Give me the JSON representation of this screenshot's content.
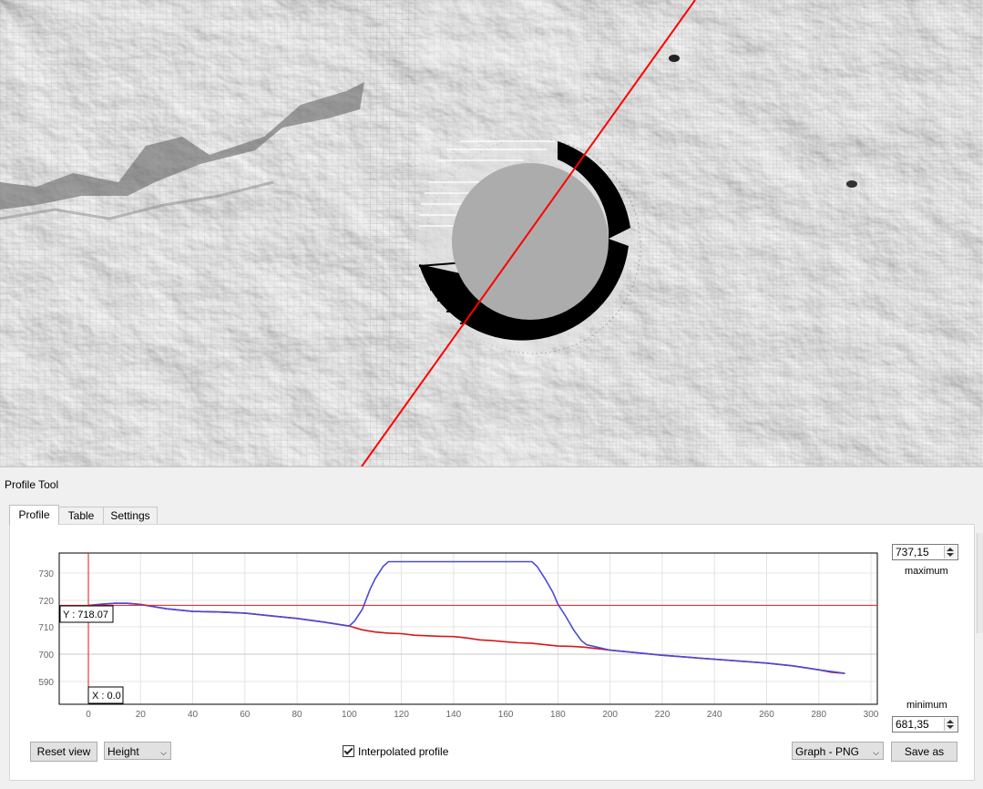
{
  "panel": {
    "title": "Profile Tool"
  },
  "tabs": [
    {
      "label": "Profile",
      "active": true
    },
    {
      "label": "Table",
      "active": false
    },
    {
      "label": "Settings",
      "active": false
    }
  ],
  "cursor": {
    "y_label": "Y : 718.07",
    "x_label": "X : 0.0",
    "x": 0,
    "y": 718.07
  },
  "range": {
    "maximum_value": "737,15",
    "maximum_label": "maximum",
    "minimum_value": "681,35",
    "minimum_label": "minimum"
  },
  "controls": {
    "reset_view": "Reset view",
    "mode_select": "Height",
    "interpolated_label": "Interpolated profile",
    "interpolated_checked": true,
    "export_format": "Graph - PNG",
    "save_as": "Save as"
  },
  "colors": {
    "profile_blue": "#4a4ad8",
    "profile_red": "#d21a1a",
    "cursor_red": "#e01818",
    "map_line": "#ff0000"
  },
  "chart_data": {
    "type": "line",
    "x_ticks": [
      "0",
      "20",
      "40",
      "60",
      "80",
      "100",
      "120",
      "140",
      "160",
      "180",
      "200",
      "220",
      "240",
      "260",
      "280",
      "300"
    ],
    "y_ticks": [
      "730",
      "720",
      "710",
      "700",
      "590"
    ],
    "xlim": [
      0,
      300
    ],
    "grid": true,
    "series": [
      {
        "color": "#4a4ad8",
        "x": [
          0,
          5,
          10,
          15,
          20,
          30,
          40,
          50,
          60,
          70,
          80,
          90,
          100,
          102,
          105,
          108,
          110,
          113,
          115,
          120,
          140,
          160,
          170,
          172,
          175,
          178,
          180,
          183,
          186,
          189,
          191,
          195,
          200,
          220,
          240,
          260,
          270,
          280,
          290
        ],
        "y": [
          718,
          718.5,
          718.8,
          718.8,
          718.4,
          716.8,
          715.8,
          715.6,
          715.2,
          714.2,
          713.2,
          711.9,
          710.4,
          712.2,
          716.5,
          724,
          728,
          732.5,
          734.2,
          734.2,
          734.2,
          734.2,
          734.2,
          732.5,
          728,
          723,
          718.5,
          714,
          709,
          705,
          703.5,
          702.6,
          701.5,
          699.6,
          698.1,
          696.7,
          695.7,
          694.2,
          692.9
        ]
      },
      {
        "color": "#d21a1a",
        "x": [
          0,
          5,
          10,
          15,
          20,
          30,
          40,
          50,
          60,
          70,
          80,
          90,
          100,
          105,
          110,
          115,
          120,
          125,
          130,
          135,
          140,
          145,
          150,
          155,
          160,
          165,
          170,
          175,
          180,
          185,
          190,
          200,
          220,
          240,
          260,
          270,
          280,
          285,
          290
        ],
        "y": [
          718,
          718.4,
          718.8,
          718.8,
          718.4,
          716.8,
          715.8,
          715.6,
          715.2,
          714.2,
          713.2,
          711.9,
          710.4,
          709,
          708.2,
          707.8,
          707.6,
          707,
          706.8,
          706.6,
          706.5,
          706,
          705.3,
          705,
          704.6,
          704.2,
          704,
          703.5,
          703,
          702.9,
          702.6,
          701.5,
          699.6,
          698.1,
          696.7,
          695.7,
          694.2,
          693.3,
          692.9
        ]
      }
    ]
  }
}
